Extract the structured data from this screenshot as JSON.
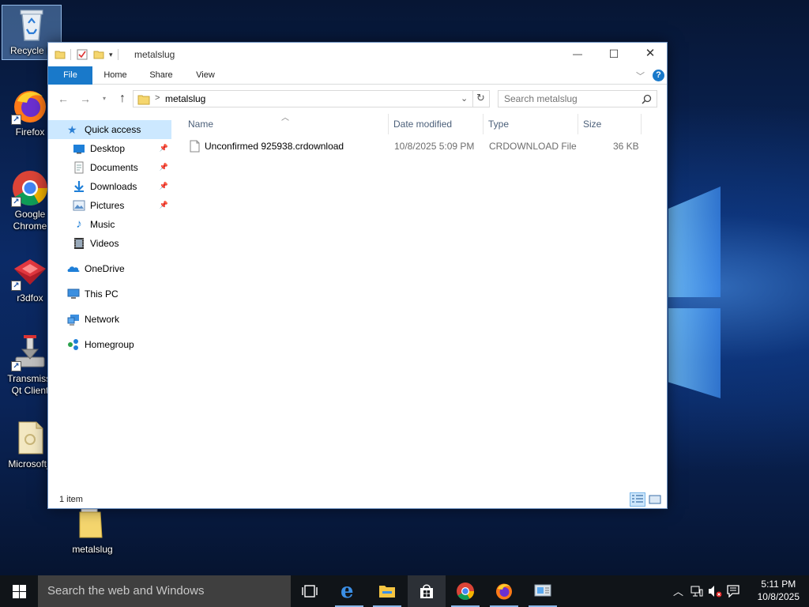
{
  "desktop": {
    "icons": [
      {
        "label": "Recycle B",
        "icon": "recycle-bin-icon"
      },
      {
        "label": "Firefox",
        "icon": "firefox-icon"
      },
      {
        "label": "Google Chrome",
        "label_line1": "Google",
        "label_line2": "Chrome",
        "icon": "chrome-icon"
      },
      {
        "label": "r3dfox",
        "icon": "r3dfox-icon"
      },
      {
        "label": "Transmissi Qt Client",
        "label_line1": "Transmissi",
        "label_line2": "Qt Client",
        "icon": "transmission-icon"
      },
      {
        "label": "Microsoft_",
        "icon": "document-icon"
      },
      {
        "label": "metalslug",
        "icon": "folder-icon"
      }
    ]
  },
  "explorer": {
    "title": "metalslug",
    "window_buttons": {
      "minimize": "—",
      "maximize": "☐",
      "close": "✕"
    },
    "ribbon_tabs": [
      "File",
      "Home",
      "Share",
      "View"
    ],
    "address": {
      "path_separator": ">",
      "current": "metalslug"
    },
    "search": {
      "placeholder": "Search metalslug"
    },
    "nav": {
      "quick_access": "Quick access",
      "items": [
        {
          "label": "Desktop",
          "pinned": true
        },
        {
          "label": "Documents",
          "pinned": true
        },
        {
          "label": "Downloads",
          "pinned": true
        },
        {
          "label": "Pictures",
          "pinned": true
        },
        {
          "label": "Music",
          "pinned": false
        },
        {
          "label": "Videos",
          "pinned": false
        }
      ],
      "onedrive": "OneDrive",
      "this_pc": "This PC",
      "network": "Network",
      "homegroup": "Homegroup"
    },
    "columns": {
      "name": "Name",
      "date_modified": "Date modified",
      "type": "Type",
      "size": "Size"
    },
    "files": [
      {
        "name": "Unconfirmed 925938.crdownload",
        "date_modified": "10/8/2025 5:09 PM",
        "type": "CRDOWNLOAD File",
        "size": "36 KB"
      }
    ],
    "status": {
      "item_count": "1 item"
    }
  },
  "taskbar": {
    "search_placeholder": "Search the web and Windows",
    "apps": [
      "task-view",
      "edge",
      "file-explorer",
      "store",
      "chrome",
      "firefox",
      "control-panel"
    ],
    "clock": {
      "time": "5:11 PM",
      "date": "10/8/2025"
    }
  },
  "colors": {
    "accent": "#1979ca",
    "selection": "#cce8ff",
    "taskbar": "#101418"
  }
}
